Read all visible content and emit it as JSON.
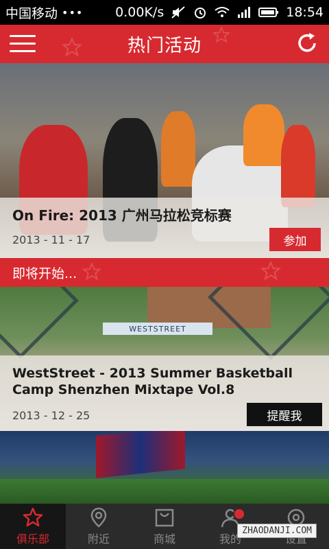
{
  "status_bar": {
    "carrier": "中国移动",
    "dots": "•••",
    "speed": "0.00K/s",
    "time": "18:54"
  },
  "header": {
    "title": "热门活动"
  },
  "featured_event": {
    "title": "On Fire: 2013 广州马拉松竞标赛",
    "date": "2013 - 11 - 17",
    "action_label": "参加"
  },
  "upcoming_section": {
    "label": "即将开始..."
  },
  "upcoming_event": {
    "title": "WestStreet - 2013 Summer Basketball Camp Shenzhen Mixtape Vol.8",
    "banner_text": "WESTSTREET",
    "date": "2013 - 12 - 25",
    "action_label": "提醒我"
  },
  "bottom_nav": {
    "items": [
      {
        "label": "俱乐部",
        "icon": "star-icon",
        "active": true
      },
      {
        "label": "附近",
        "icon": "location-pin-icon",
        "active": false
      },
      {
        "label": "商城",
        "icon": "shopping-bag-icon",
        "active": false
      },
      {
        "label": "我的",
        "icon": "user-icon",
        "active": false,
        "badge": true
      },
      {
        "label": "设置",
        "icon": "settings-icon",
        "active": false
      }
    ]
  },
  "watermark": "ZHAODANJI.COM",
  "colors": {
    "accent": "#d72a30",
    "nav_bg": "#2b2b2b",
    "nav_active_bg": "#161616"
  }
}
